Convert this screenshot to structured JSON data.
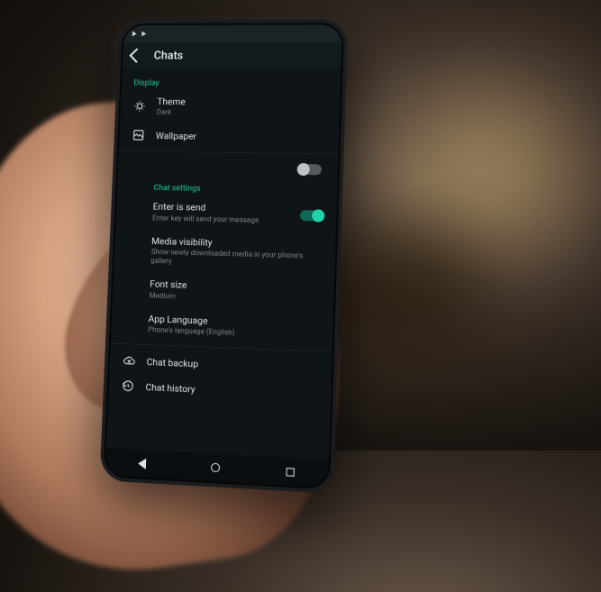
{
  "appbar": {
    "title": "Chats"
  },
  "sections": {
    "display": {
      "label": "Display",
      "theme": {
        "label": "Theme",
        "value": "Dark"
      },
      "wallpaper": {
        "label": "Wallpaper"
      }
    },
    "chat": {
      "label": "Chat settings",
      "enter_is_send": {
        "label": "Enter is send",
        "sub": "Enter key will send your message",
        "on": true
      },
      "media_visibility": {
        "label": "Media visibility",
        "sub": "Show newly downloaded media in your phone's gallery"
      },
      "font_size": {
        "label": "Font size",
        "value": "Medium"
      },
      "app_language": {
        "label": "App Language",
        "value": "Phone's language (English)"
      }
    },
    "backup": {
      "chat_backup": {
        "label": "Chat backup"
      },
      "chat_history": {
        "label": "Chat history"
      }
    }
  },
  "unknown_toggle": {
    "on": false
  }
}
